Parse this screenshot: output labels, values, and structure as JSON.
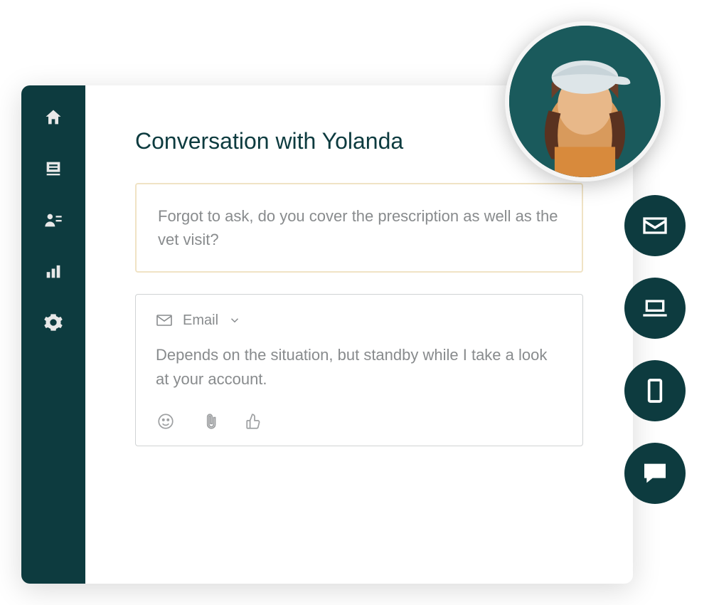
{
  "title": "Conversation with Yolanda",
  "incoming_message": "Forgot to ask, do you cover the prescription as well as the vet visit?",
  "reply": {
    "channel_label": "Email",
    "text": "Depends on the situation, but standby while I take a look at your account."
  },
  "sidebar": {
    "items": [
      "home",
      "inbox",
      "contacts",
      "stats",
      "settings"
    ]
  },
  "quick_channels": [
    "email",
    "laptop",
    "tablet",
    "chat"
  ]
}
